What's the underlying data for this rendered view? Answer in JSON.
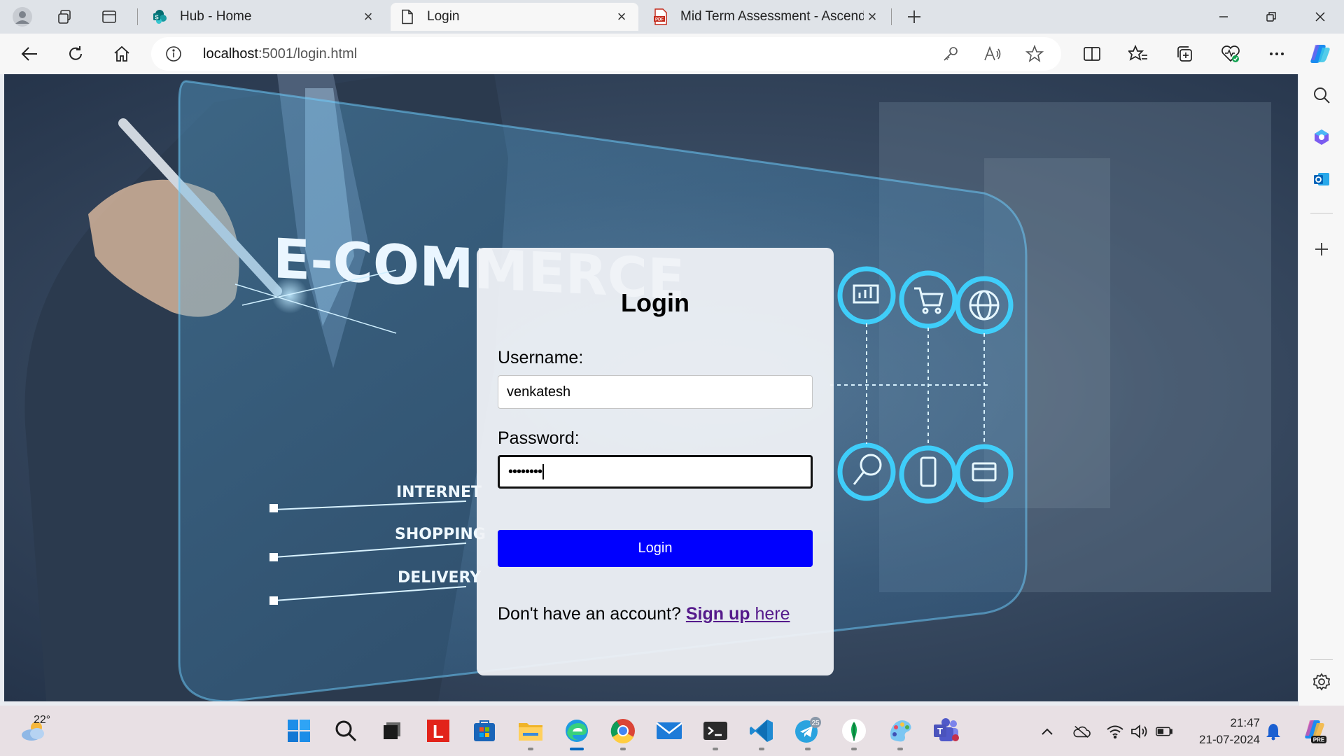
{
  "browser": {
    "tabs": [
      {
        "title": "Hub - Home",
        "icon": "sharepoint-icon"
      },
      {
        "title": "Login",
        "icon": "page-icon"
      },
      {
        "title": "Mid Term Assessment - Ascendio",
        "icon": "pdf-icon"
      }
    ],
    "active_tab": 1,
    "url_host": "localhost",
    "url_path": ":5001/login.html"
  },
  "background": {
    "headline": "E-COMMERCE",
    "items": [
      "INTERNET",
      "SHOPPING",
      "DELIVERY"
    ]
  },
  "login": {
    "title": "Login",
    "username_label": "Username:",
    "username_value": "venkatesh",
    "password_label": "Password:",
    "password_value": "••••••••",
    "button_label": "Login",
    "signup_prompt": "Don't have an account?",
    "signup_link_bold": "Sign up",
    "signup_link_rest": " here"
  },
  "taskbar": {
    "weather_temp": "22°",
    "time": "21:47",
    "date": "21-07-2024",
    "telegram_badge": "25"
  },
  "colors": {
    "login_button": "#0000ff",
    "link": "#551a8b",
    "accent": "#0067c0"
  }
}
